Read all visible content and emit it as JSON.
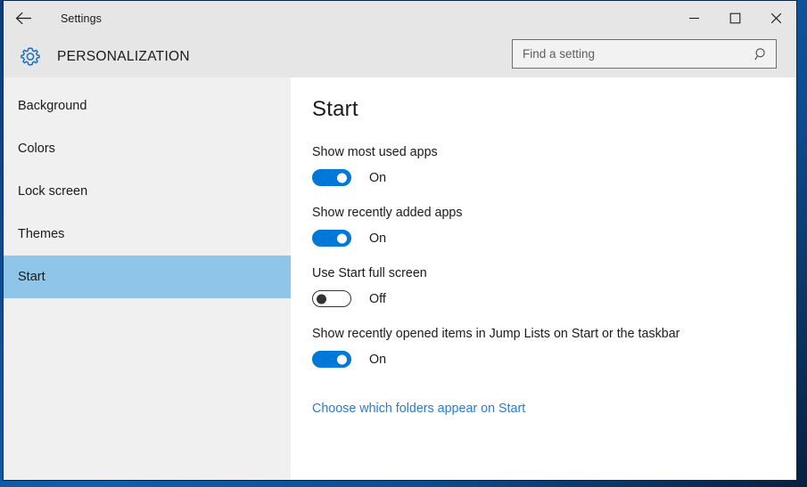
{
  "window": {
    "title": "Settings",
    "back_icon": "back-arrow-icon",
    "controls": {
      "minimize": "minimize-icon",
      "maximize": "maximize-icon",
      "close": "close-icon"
    }
  },
  "header": {
    "icon": "gear-icon",
    "category": "PERSONALIZATION",
    "accent_color": "#0078d7"
  },
  "search": {
    "placeholder": "Find a setting",
    "value": "",
    "icon": "search-icon"
  },
  "sidebar": {
    "items": [
      {
        "label": "Background",
        "selected": false
      },
      {
        "label": "Colors",
        "selected": false
      },
      {
        "label": "Lock screen",
        "selected": false
      },
      {
        "label": "Themes",
        "selected": false
      },
      {
        "label": "Start",
        "selected": true
      }
    ],
    "selected_color": "#8ec5e8",
    "background_color": "#f0f0f0"
  },
  "main": {
    "title": "Start",
    "settings": [
      {
        "label": "Show most used apps",
        "state": "On",
        "on": true
      },
      {
        "label": "Show recently added apps",
        "state": "On",
        "on": true
      },
      {
        "label": "Use Start full screen",
        "state": "Off",
        "on": false
      },
      {
        "label": "Show recently opened items in Jump Lists on Start or the taskbar",
        "state": "On",
        "on": true
      }
    ],
    "link": {
      "label": "Choose which folders appear on Start",
      "color": "#2a7ad2"
    }
  }
}
